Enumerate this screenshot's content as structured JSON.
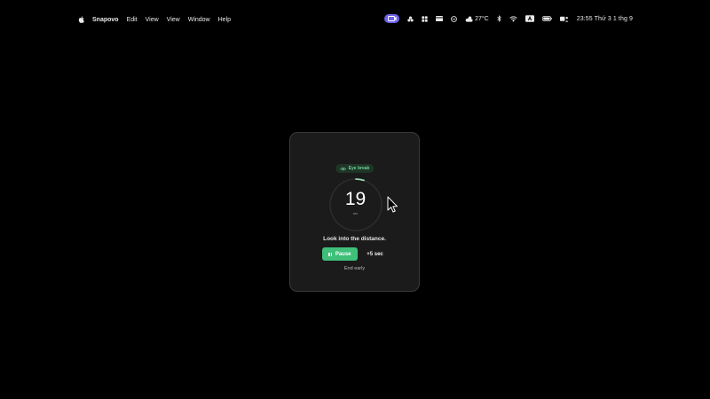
{
  "menubar": {
    "app_name": "Snapovo",
    "menus": [
      "Edit",
      "View",
      "View",
      "Window",
      "Help"
    ],
    "status_icons": [
      "screen-capture-icon",
      "tools-icon",
      "grid-icon",
      "card-icon",
      "circle-icon",
      "weather-icon",
      "bluetooth-icon",
      "wifi-icon",
      "text-input-icon",
      "battery-icon",
      "user-switch-icon"
    ],
    "weather_temp": "27°C",
    "clock": "23:55 Thứ 3 1 thg 9"
  },
  "eye_break": {
    "badge_label": "Eye break",
    "countdown": "19",
    "unit": "sec",
    "instruction": "Look into the distance.",
    "pause_label": "Pause",
    "extend_label": "+5 sec",
    "end_label": "End early",
    "progress_fraction": 0.05,
    "accent_color": "#3fbf79"
  }
}
